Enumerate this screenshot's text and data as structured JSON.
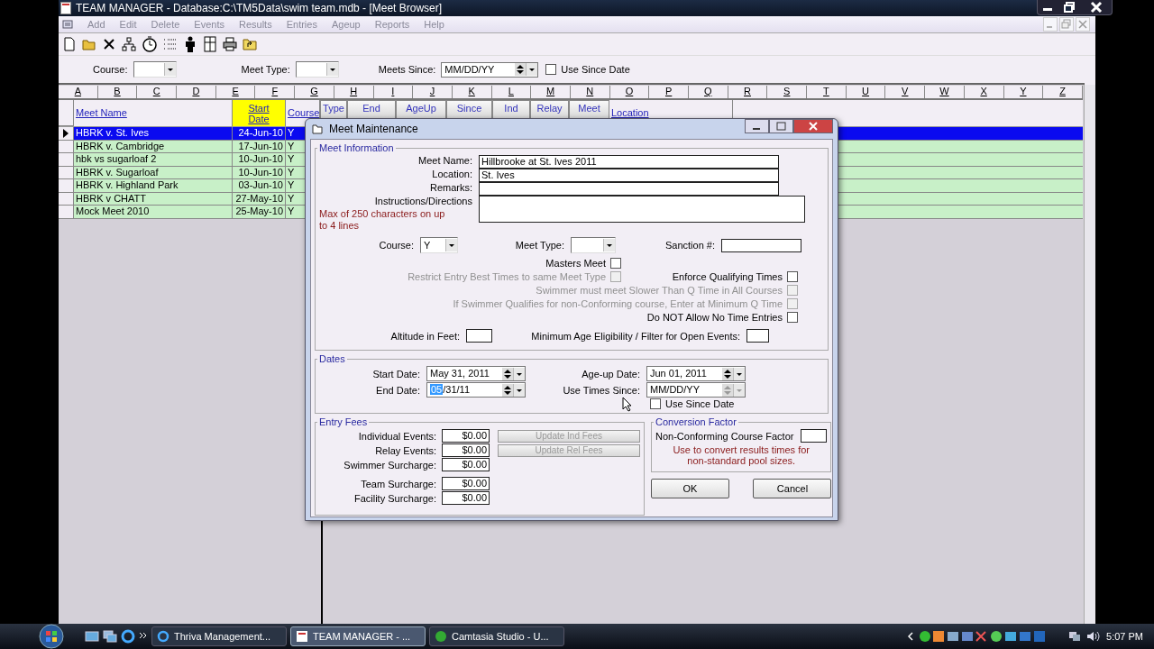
{
  "window": {
    "title": "TEAM MANAGER - Database:C:\\TM5Data\\swim team.mdb - [Meet Browser]"
  },
  "menu": [
    {
      "label": "Add",
      "disabled": true
    },
    {
      "label": "Edit",
      "disabled": true
    },
    {
      "label": "Delete",
      "disabled": true
    },
    {
      "label": "Events",
      "disabled": true
    },
    {
      "label": "Results",
      "disabled": true
    },
    {
      "label": "Entries",
      "disabled": true
    },
    {
      "label": "Ageup",
      "disabled": true
    },
    {
      "label": "Reports",
      "disabled": true
    },
    {
      "label": "Help",
      "disabled": true
    }
  ],
  "filters": {
    "course": {
      "label": "Course:"
    },
    "meet_type": {
      "label": "Meet Type:"
    },
    "meets_since": {
      "label": "Meets Since:",
      "value": "MM/DD/YY"
    },
    "use_since_date": {
      "label": "Use Since Date",
      "checked": false
    }
  },
  "column_letters": [
    "A",
    "B",
    "C",
    "D",
    "E",
    "F",
    "G",
    "H",
    "I",
    "J",
    "K",
    "L",
    "M",
    "N",
    "O",
    "P",
    "Q",
    "R",
    "S",
    "T",
    "U",
    "V",
    "W",
    "X",
    "Y",
    "Z"
  ],
  "grid_columns": [
    {
      "label": "Meet Name",
      "kind": "link",
      "selected": false
    },
    {
      "label": "Start Date",
      "kind": "link",
      "selected": true
    },
    {
      "label": "Course",
      "kind": "link",
      "selected": false
    },
    {
      "label": "Type",
      "kind": "button",
      "selected": false
    },
    {
      "label": "End",
      "kind": "button",
      "selected": false
    },
    {
      "label": "AgeUp",
      "kind": "button",
      "selected": false
    },
    {
      "label": "Since",
      "kind": "button",
      "selected": false
    },
    {
      "label": "Ind",
      "kind": "button",
      "selected": false
    },
    {
      "label": "Relay",
      "kind": "button",
      "selected": false
    },
    {
      "label": "Meet",
      "kind": "button",
      "selected": false
    },
    {
      "label": "Location",
      "kind": "link",
      "selected": false
    }
  ],
  "rows": [
    {
      "name": "HBRK v. St. Ives",
      "start_date": "24-Jun-10",
      "course": "Y",
      "selected": true
    },
    {
      "name": "HBRK v. Cambridge",
      "start_date": "17-Jun-10",
      "course": "Y",
      "selected": false
    },
    {
      "name": "hbk vs sugarloaf 2",
      "start_date": "10-Jun-10",
      "course": "Y",
      "selected": false
    },
    {
      "name": "HBRK v. Sugarloaf",
      "start_date": "10-Jun-10",
      "course": "Y",
      "selected": false
    },
    {
      "name": "HBRK v. Highland Park",
      "start_date": "03-Jun-10",
      "course": "Y",
      "selected": false
    },
    {
      "name": "HBRK v CHATT",
      "start_date": "27-May-10",
      "course": "Y",
      "selected": false
    },
    {
      "name": "Mock Meet  2010",
      "start_date": "25-May-10",
      "course": "Y",
      "selected": false
    }
  ],
  "dialog": {
    "title": "Meet Maintenance",
    "meet_information": {
      "legend": "Meet Information",
      "meet_name": {
        "label": "Meet Name:",
        "value": "Hillbrooke at St. Ives 2011"
      },
      "location": {
        "label": "Location:",
        "value": "St. Ives"
      },
      "remarks": {
        "label": "Remarks:"
      },
      "instructions": {
        "label": "Instructions/Directions",
        "hint": "Max of 250 characters on up to 4 lines"
      },
      "course": {
        "label": "Course:",
        "value": "Y"
      },
      "meet_type": {
        "label": "Meet Type:"
      },
      "sanction": {
        "label": "Sanction #:"
      },
      "masters_meet": {
        "label": "Masters Meet",
        "checked": false,
        "disabled": false
      },
      "restrict_entry": {
        "label": "Restrict Entry Best Times to same Meet Type",
        "checked": false,
        "disabled": true
      },
      "enforce_qualifying": {
        "label": "Enforce Qualifying Times",
        "checked": false,
        "disabled": false
      },
      "slower_than_q": {
        "label": "Swimmer must meet Slower Than Q Time in All Courses",
        "checked": false,
        "disabled": true
      },
      "non_conforming_min_q": {
        "label": "If Swimmer Qualifies for non-Conforming course, Enter at Minimum Q Time",
        "checked": false,
        "disabled": true
      },
      "no_time_entries": {
        "label": "Do NOT Allow No Time Entries",
        "checked": false,
        "disabled": false
      },
      "altitude": {
        "label": "Altitude in Feet:"
      },
      "min_age": {
        "label": "Minimum Age Eligibility / Filter for Open Events:"
      }
    },
    "dates": {
      "legend": "Dates",
      "start_date": {
        "label": "Start Date:",
        "value": "May 31, 2011"
      },
      "end_date": {
        "label": "End Date:",
        "selected_part": "05",
        "value_rest": "/31/11"
      },
      "ageup_date": {
        "label": "Age-up Date:",
        "value": "Jun 01, 2011"
      },
      "use_times_since": {
        "label": "Use Times Since:",
        "value": "MM/DD/YY"
      },
      "use_since_date": {
        "label": "Use Since Date",
        "checked": false
      }
    },
    "entry_fees": {
      "legend": "Entry Fees",
      "individual": {
        "label": "Individual Events:",
        "value": "$0.00"
      },
      "relay": {
        "label": "Relay Events:",
        "value": "$0.00"
      },
      "swimmer": {
        "label": "Swimmer Surcharge:",
        "value": "$0.00"
      },
      "team": {
        "label": "Team Surcharge:",
        "value": "$0.00"
      },
      "facility": {
        "label": "Facility Surcharge:",
        "value": "$0.00"
      },
      "update_ind": {
        "label": "Update Ind Fees",
        "disabled": true
      },
      "update_rel": {
        "label": "Update Rel Fees",
        "disabled": true
      }
    },
    "conversion": {
      "legend": "Conversion Factor",
      "label": "Non-Conforming Course Factor",
      "note": "Use to convert results times for non-standard pool sizes."
    },
    "ok": "OK",
    "cancel": "Cancel"
  },
  "taskbar": {
    "tasks": [
      {
        "label": "Thriva Management...",
        "selected": false
      },
      {
        "label": "TEAM MANAGER - ...",
        "selected": true
      },
      {
        "label": "Camtasia Studio - U...",
        "selected": false
      }
    ],
    "clock": "5:07 PM"
  }
}
